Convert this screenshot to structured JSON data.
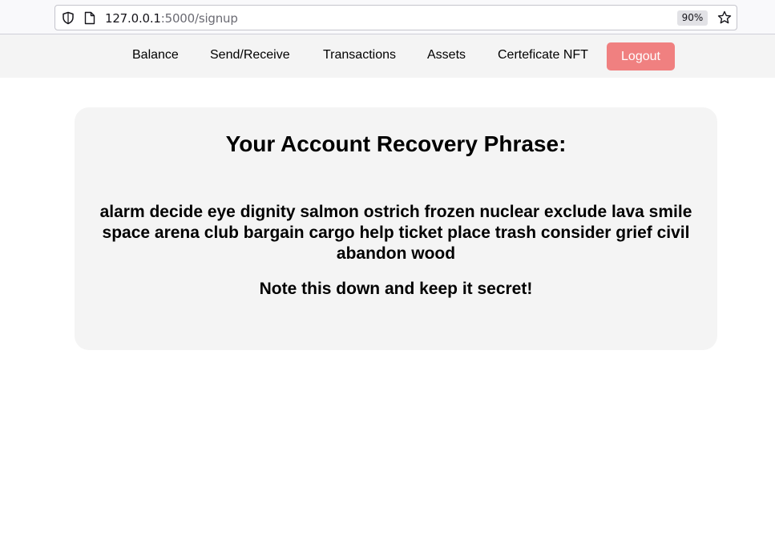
{
  "browser": {
    "url_host": "127.0.0.1",
    "url_path": ":5000/signup",
    "zoom": "90%"
  },
  "nav": {
    "items": [
      {
        "label": "Balance"
      },
      {
        "label": "Send/Receive"
      },
      {
        "label": "Transactions"
      },
      {
        "label": "Assets"
      },
      {
        "label": "Certeficate NFT"
      }
    ],
    "logout_label": "Logout",
    "logout_color": "#f08080"
  },
  "card": {
    "title": "Your Account Recovery Phrase:",
    "phrase": "alarm decide eye dignity salmon ostrich frozen nuclear exclude lava smile space arena club bargain cargo help ticket place trash consider grief civil abandon wood",
    "note": "Note this down and keep it secret!"
  }
}
